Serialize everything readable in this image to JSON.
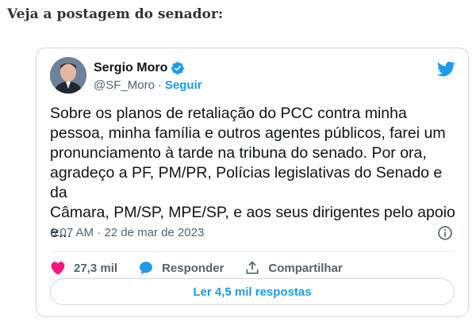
{
  "page": {
    "heading": "Veja a postagem do senador:"
  },
  "tweet": {
    "author_name": "Sergio Moro",
    "handle": "@SF_Moro",
    "separator": "·",
    "follow_label": "Seguir",
    "text": "Sobre os planos de retaliação do PCC contra minha\npessoa, minha família e outros agentes públicos, farei um\npronunciamento à tarde na tribuna do senado. Por ora,\nagradeço a PF, PM/PR, Polícias legislativas do Senado e da\nCâmara, PM/SP, MPE/SP, e aos seus dirigentes pelo apoio\ne...",
    "timestamp": "6:07 AM · 22 de mar de 2023",
    "likes": "27,3 mil",
    "reply_label": "Responder",
    "share_label": "Compartilhar",
    "read_replies_label": "Ler 4,5 mil respostas"
  },
  "colors": {
    "accent": "#1d9bf0",
    "like": "#f91880",
    "muted": "#536471"
  },
  "icons": [
    "verified-badge-icon",
    "twitter-bird-icon",
    "info-icon",
    "heart-icon",
    "reply-icon",
    "share-icon"
  ]
}
